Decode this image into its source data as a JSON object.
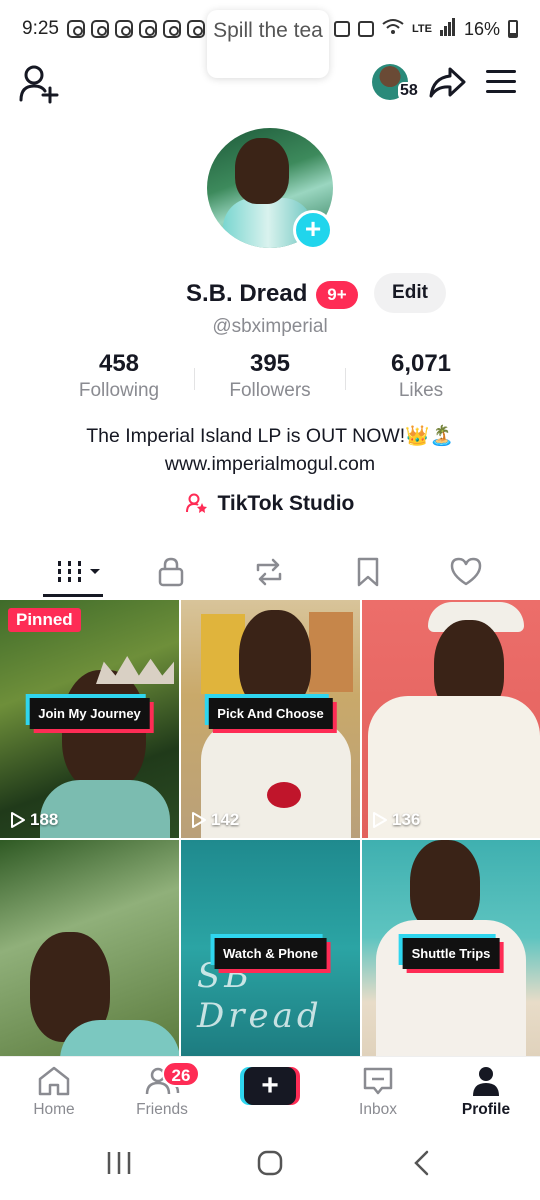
{
  "status_bar": {
    "time": "9:25",
    "network": "LTE",
    "battery_percent": "16%"
  },
  "header": {
    "tooltip": "Spill the tea",
    "mini_profile_count": "58"
  },
  "profile": {
    "display_name": "S.B. Dread",
    "notification_badge": "9+",
    "edit_label": "Edit",
    "handle": "@sbximperial",
    "bio_line1": "The Imperial Island LP is OUT NOW!👑🏝️",
    "bio_line2": "www.imperialmogul.com",
    "studio_label": "TikTok Studio"
  },
  "stats": [
    {
      "value": "458",
      "label": "Following"
    },
    {
      "value": "395",
      "label": "Followers"
    },
    {
      "value": "6,071",
      "label": "Likes"
    }
  ],
  "tabs": [
    "videos-tab",
    "private-tab",
    "reposts-tab",
    "saved-tab",
    "liked-tab"
  ],
  "videos": [
    {
      "caption": "Join My Journey",
      "views": "188",
      "pinned": "Pinned"
    },
    {
      "caption": "Pick And Choose",
      "views": "142"
    },
    {
      "caption": "",
      "views": "136"
    },
    {
      "caption": "",
      "views": ""
    },
    {
      "caption": "Watch & Phone",
      "views": ""
    },
    {
      "caption": "Shuttle Trips",
      "views": ""
    }
  ],
  "bottom_nav": {
    "home": "Home",
    "friends": "Friends",
    "friends_badge": "26",
    "inbox": "Inbox",
    "profile": "Profile"
  },
  "colors": {
    "accent_red": "#fe2c55",
    "accent_cyan": "#20d5ec",
    "text_primary": "#161823",
    "text_secondary": "#8a8b91"
  }
}
